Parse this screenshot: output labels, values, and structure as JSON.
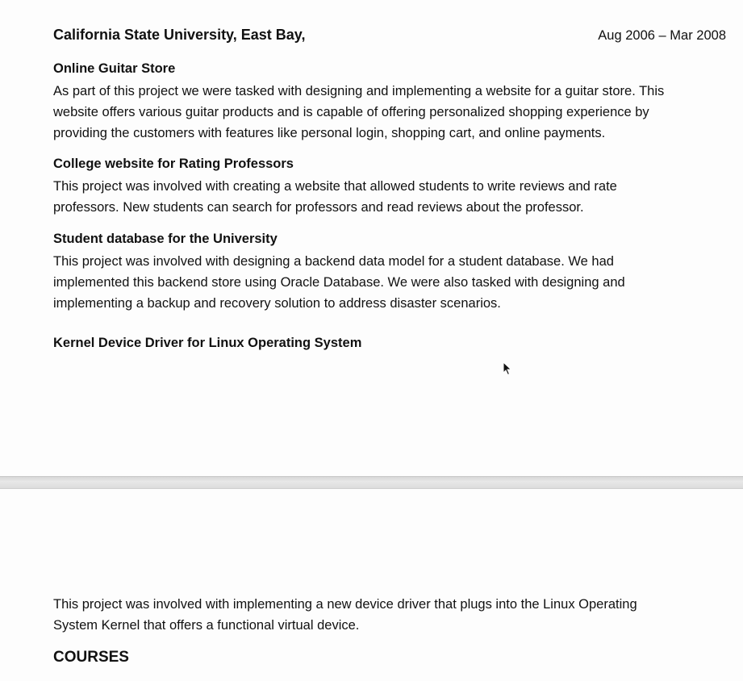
{
  "education": {
    "institution": "California State University, East Bay,",
    "dates": "Aug 2006 – Mar 2008"
  },
  "projects": [
    {
      "title": "Online Guitar Store",
      "description_lines": [
        "As part of this project we were tasked with designing and implementing a website for a guitar store. This",
        "website offers various guitar products and is capable of offering personalized shopping experience by",
        "providing the customers with features like personal login, shopping cart, and online payments."
      ]
    },
    {
      "title": "College website for Rating Professors",
      "description_lines": [
        "This project was involved with creating a website that allowed students to write reviews and rate",
        "professors. New students can search for professors and read reviews about the professor."
      ]
    },
    {
      "title": "Student database for the University",
      "description_lines": [
        "This project was involved with designing a backend data model for a student database. We had",
        "implemented this backend store using Oracle Database. We were also tasked with designing and",
        "implementing a backup and recovery solution to address disaster scenarios."
      ]
    },
    {
      "title": "Kernel Device Driver for Linux Operating System",
      "description_lines": [
        "This project was involved with implementing a new device driver that plugs into the Linux Operating",
        "System Kernel that offers a functional virtual device."
      ]
    }
  ],
  "sections": {
    "courses_heading": "COURSES"
  },
  "icons": {
    "cursor": "mouse-pointer-icon"
  }
}
